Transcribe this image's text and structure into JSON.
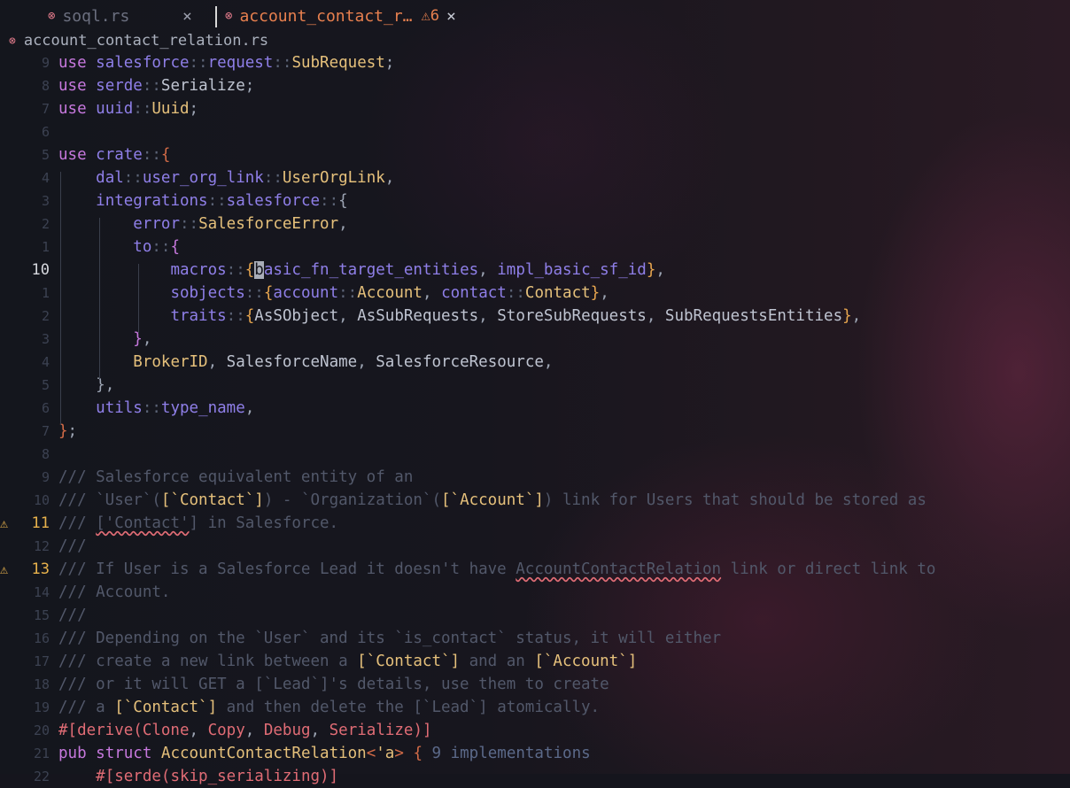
{
  "tabs": [
    {
      "name": "soql.rs",
      "status_icon": "error-icon",
      "close": "×"
    },
    {
      "name": "account_contact_r…",
      "status_icon": "error-icon",
      "warning_count": "6",
      "close": "×"
    }
  ],
  "breadcrumb": {
    "file": "account_contact_relation.rs",
    "status_icon": "error-icon"
  },
  "lines": [
    {
      "n": "9"
    },
    {
      "n": "8"
    },
    {
      "n": "7"
    },
    {
      "n": "6"
    },
    {
      "n": "5"
    },
    {
      "n": "4"
    },
    {
      "n": "3"
    },
    {
      "n": "2"
    },
    {
      "n": "1"
    },
    {
      "n": "10",
      "current": true
    },
    {
      "n": "1"
    },
    {
      "n": "2"
    },
    {
      "n": "3"
    },
    {
      "n": "4"
    },
    {
      "n": "5"
    },
    {
      "n": "6"
    },
    {
      "n": "7"
    },
    {
      "n": "8"
    },
    {
      "n": "9"
    },
    {
      "n": "10"
    },
    {
      "n": "11",
      "warning": true
    },
    {
      "n": "12"
    },
    {
      "n": "13",
      "warning": true
    },
    {
      "n": "14"
    },
    {
      "n": "15"
    },
    {
      "n": "16"
    },
    {
      "n": "17"
    },
    {
      "n": "18"
    },
    {
      "n": "19"
    },
    {
      "n": "20"
    },
    {
      "n": "21"
    },
    {
      "n": "22"
    }
  ],
  "inlay_hint": "9 implementations",
  "colors": {
    "background": "#15151d",
    "keyword": "#c678dd",
    "module": "#8f7fe8",
    "type": "#e5c07b",
    "comment": "#52586a",
    "active_tab": "#e8804f",
    "warning": "#e8b24c"
  }
}
